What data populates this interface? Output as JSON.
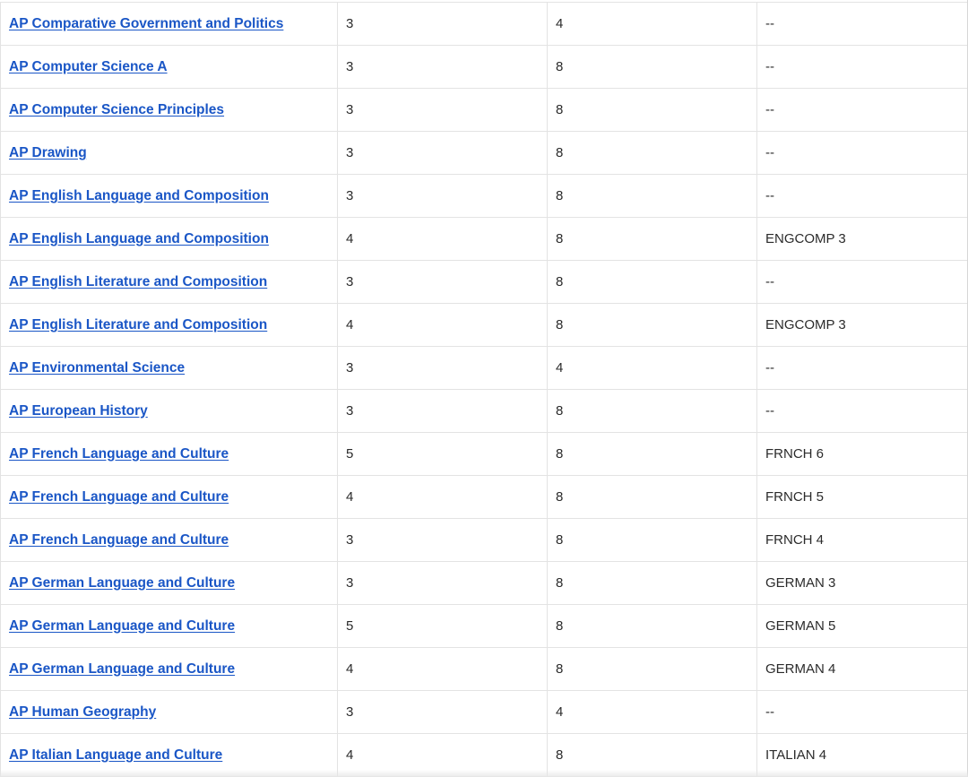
{
  "table": {
    "rows": [
      {
        "exam": "AP Comparative Government and Politics",
        "score": "3",
        "units": "4",
        "course": "--"
      },
      {
        "exam": "AP Computer Science A",
        "score": "3",
        "units": "8",
        "course": "--"
      },
      {
        "exam": "AP Computer Science Principles",
        "score": "3",
        "units": "8",
        "course": "--"
      },
      {
        "exam": "AP Drawing",
        "score": "3",
        "units": "8",
        "course": "--"
      },
      {
        "exam": "AP English Language and Composition",
        "score": "3",
        "units": "8",
        "course": "--"
      },
      {
        "exam": "AP English Language and Composition",
        "score": "4",
        "units": "8",
        "course": "ENGCOMP 3"
      },
      {
        "exam": "AP English Literature and Composition",
        "score": "3",
        "units": "8",
        "course": "--"
      },
      {
        "exam": "AP English Literature and Composition",
        "score": "4",
        "units": "8",
        "course": "ENGCOMP 3"
      },
      {
        "exam": "AP Environmental Science",
        "score": "3",
        "units": "4",
        "course": "--"
      },
      {
        "exam": "AP European History",
        "score": "3",
        "units": "8",
        "course": "--"
      },
      {
        "exam": "AP French Language and Culture",
        "score": "5",
        "units": "8",
        "course": "FRNCH 6"
      },
      {
        "exam": "AP French Language and Culture",
        "score": "4",
        "units": "8",
        "course": "FRNCH 5"
      },
      {
        "exam": "AP French Language and Culture",
        "score": "3",
        "units": "8",
        "course": "FRNCH 4"
      },
      {
        "exam": "AP German Language and Culture",
        "score": "3",
        "units": "8",
        "course": "GERMAN 3"
      },
      {
        "exam": "AP German Language and Culture",
        "score": "5",
        "units": "8",
        "course": "GERMAN 5"
      },
      {
        "exam": "AP German Language and Culture",
        "score": "4",
        "units": "8",
        "course": "GERMAN 4"
      },
      {
        "exam": "AP Human Geography",
        "score": "3",
        "units": "4",
        "course": "--"
      },
      {
        "exam": "AP Italian Language and Culture",
        "score": "4",
        "units": "8",
        "course": "ITALIAN 4"
      }
    ]
  },
  "colors": {
    "link": "#1a56c6",
    "border": "#e3e3e3",
    "text": "#2b2b2b"
  }
}
